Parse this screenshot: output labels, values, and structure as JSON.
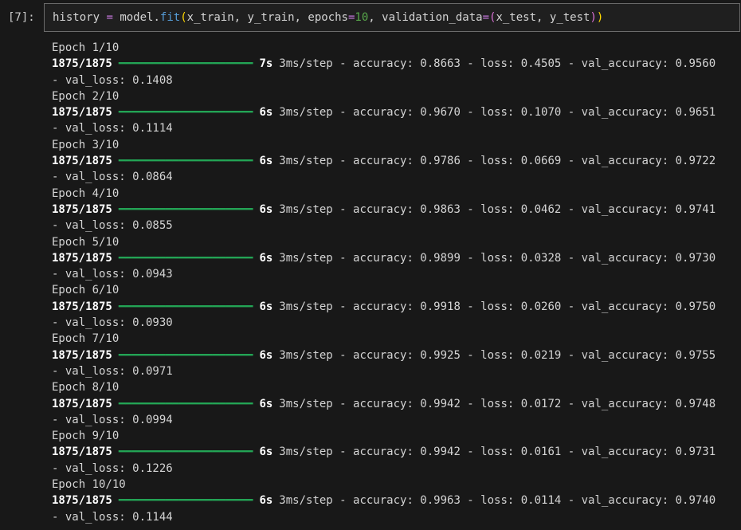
{
  "cell": {
    "execution_count": "[7]:",
    "code_text": "history = model.fit(x_train, y_train, epochs=10, validation_data=(x_test, y_test))",
    "palette": {
      "identifier": "#d4d4d4",
      "plain": "#d4d4d4",
      "operator": "#c678dd",
      "function": "#569cd6",
      "number": "#57a64a",
      "bracket1": "#ffd700",
      "bracket2": "#da70d6"
    },
    "code_tokens": [
      {
        "t": "history",
        "s": "identifier"
      },
      {
        "t": " ",
        "s": "plain"
      },
      {
        "t": "=",
        "s": "operator"
      },
      {
        "t": " ",
        "s": "plain"
      },
      {
        "t": "model",
        "s": "identifier"
      },
      {
        "t": ".",
        "s": "plain"
      },
      {
        "t": "fit",
        "s": "function"
      },
      {
        "t": "(",
        "s": "bracket1"
      },
      {
        "t": "x_train",
        "s": "identifier"
      },
      {
        "t": ", ",
        "s": "plain"
      },
      {
        "t": "y_train",
        "s": "identifier"
      },
      {
        "t": ", ",
        "s": "plain"
      },
      {
        "t": "epochs",
        "s": "identifier"
      },
      {
        "t": "=",
        "s": "operator"
      },
      {
        "t": "10",
        "s": "number"
      },
      {
        "t": ", ",
        "s": "plain"
      },
      {
        "t": "validation_data",
        "s": "identifier"
      },
      {
        "t": "=",
        "s": "operator"
      },
      {
        "t": "(",
        "s": "bracket2"
      },
      {
        "t": "x_test",
        "s": "identifier"
      },
      {
        "t": ", ",
        "s": "plain"
      },
      {
        "t": "y_test",
        "s": "identifier"
      },
      {
        "t": ")",
        "s": "bracket2"
      },
      {
        "t": ")",
        "s": "bracket1"
      }
    ]
  },
  "output": {
    "progress_bar": {
      "char": "━",
      "segments": 20,
      "color": "#23a455"
    },
    "metric_labels": {
      "accuracy": "accuracy:",
      "loss": "loss:",
      "val_accuracy": "val_accuracy:",
      "val_loss": "val_loss:",
      "separator": " - ",
      "wrap_prefix": "- "
    },
    "epochs": [
      {
        "header": "Epoch 1/10",
        "steps": "1875/1875",
        "time": "7s",
        "rate": "3ms/step",
        "accuracy": "0.8663",
        "loss": "0.4505",
        "val_accuracy": "0.9560",
        "val_loss": "0.1408"
      },
      {
        "header": "Epoch 2/10",
        "steps": "1875/1875",
        "time": "6s",
        "rate": "3ms/step",
        "accuracy": "0.9670",
        "loss": "0.1070",
        "val_accuracy": "0.9651",
        "val_loss": "0.1114"
      },
      {
        "header": "Epoch 3/10",
        "steps": "1875/1875",
        "time": "6s",
        "rate": "3ms/step",
        "accuracy": "0.9786",
        "loss": "0.0669",
        "val_accuracy": "0.9722",
        "val_loss": "0.0864"
      },
      {
        "header": "Epoch 4/10",
        "steps": "1875/1875",
        "time": "6s",
        "rate": "3ms/step",
        "accuracy": "0.9863",
        "loss": "0.0462",
        "val_accuracy": "0.9741",
        "val_loss": "0.0855"
      },
      {
        "header": "Epoch 5/10",
        "steps": "1875/1875",
        "time": "6s",
        "rate": "3ms/step",
        "accuracy": "0.9899",
        "loss": "0.0328",
        "val_accuracy": "0.9730",
        "val_loss": "0.0943"
      },
      {
        "header": "Epoch 6/10",
        "steps": "1875/1875",
        "time": "6s",
        "rate": "3ms/step",
        "accuracy": "0.9918",
        "loss": "0.0260",
        "val_accuracy": "0.9750",
        "val_loss": "0.0930"
      },
      {
        "header": "Epoch 7/10",
        "steps": "1875/1875",
        "time": "6s",
        "rate": "3ms/step",
        "accuracy": "0.9925",
        "loss": "0.0219",
        "val_accuracy": "0.9755",
        "val_loss": "0.0971"
      },
      {
        "header": "Epoch 8/10",
        "steps": "1875/1875",
        "time": "6s",
        "rate": "3ms/step",
        "accuracy": "0.9942",
        "loss": "0.0172",
        "val_accuracy": "0.9748",
        "val_loss": "0.0994"
      },
      {
        "header": "Epoch 9/10",
        "steps": "1875/1875",
        "time": "6s",
        "rate": "3ms/step",
        "accuracy": "0.9942",
        "loss": "0.0161",
        "val_accuracy": "0.9731",
        "val_loss": "0.1226"
      },
      {
        "header": "Epoch 10/10",
        "steps": "1875/1875",
        "time": "6s",
        "rate": "3ms/step",
        "accuracy": "0.9963",
        "loss": "0.0114",
        "val_accuracy": "0.9740",
        "val_loss": "0.1144"
      }
    ]
  }
}
